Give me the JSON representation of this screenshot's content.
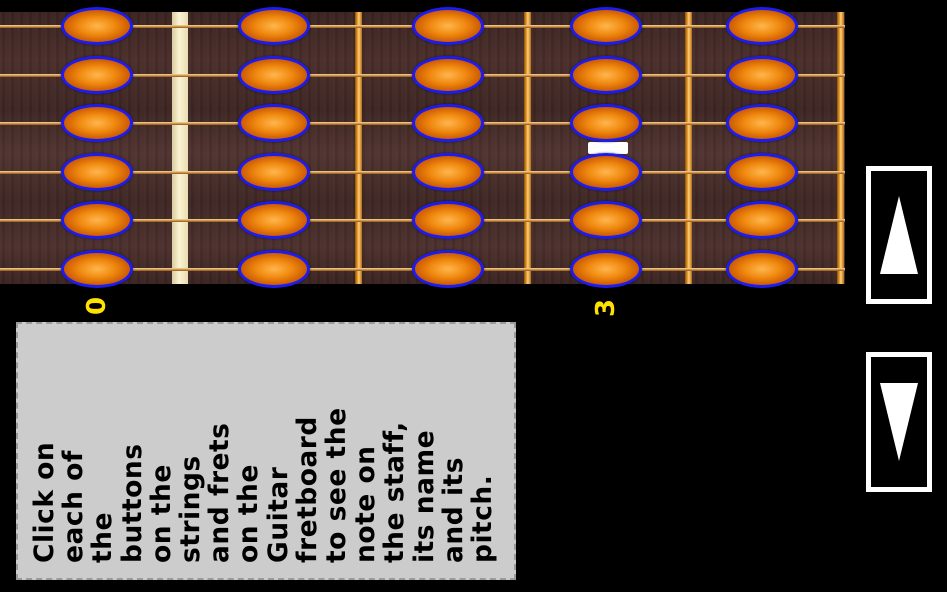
{
  "fretboard": {
    "strings": 6,
    "fret_numbers": [
      {
        "label": "0",
        "fret": 0
      },
      {
        "label": "3",
        "fret": 3
      }
    ]
  },
  "info_panel": {
    "text": "Click on\neach of\nthe\nbuttons\non the\nstrings\nand frets\non the\nGuitar\nfretboard\nto see the\nnote on\nthe staff,\nits name\nand its\npitch."
  },
  "controls": {
    "up_icon": "up-triangle",
    "down_icon": "down-triangle"
  },
  "colors": {
    "note_fill": "#f08a10",
    "note_border": "#1c1cf0",
    "fret_label": "#ffe200",
    "panel_bg": "#cccccc"
  }
}
